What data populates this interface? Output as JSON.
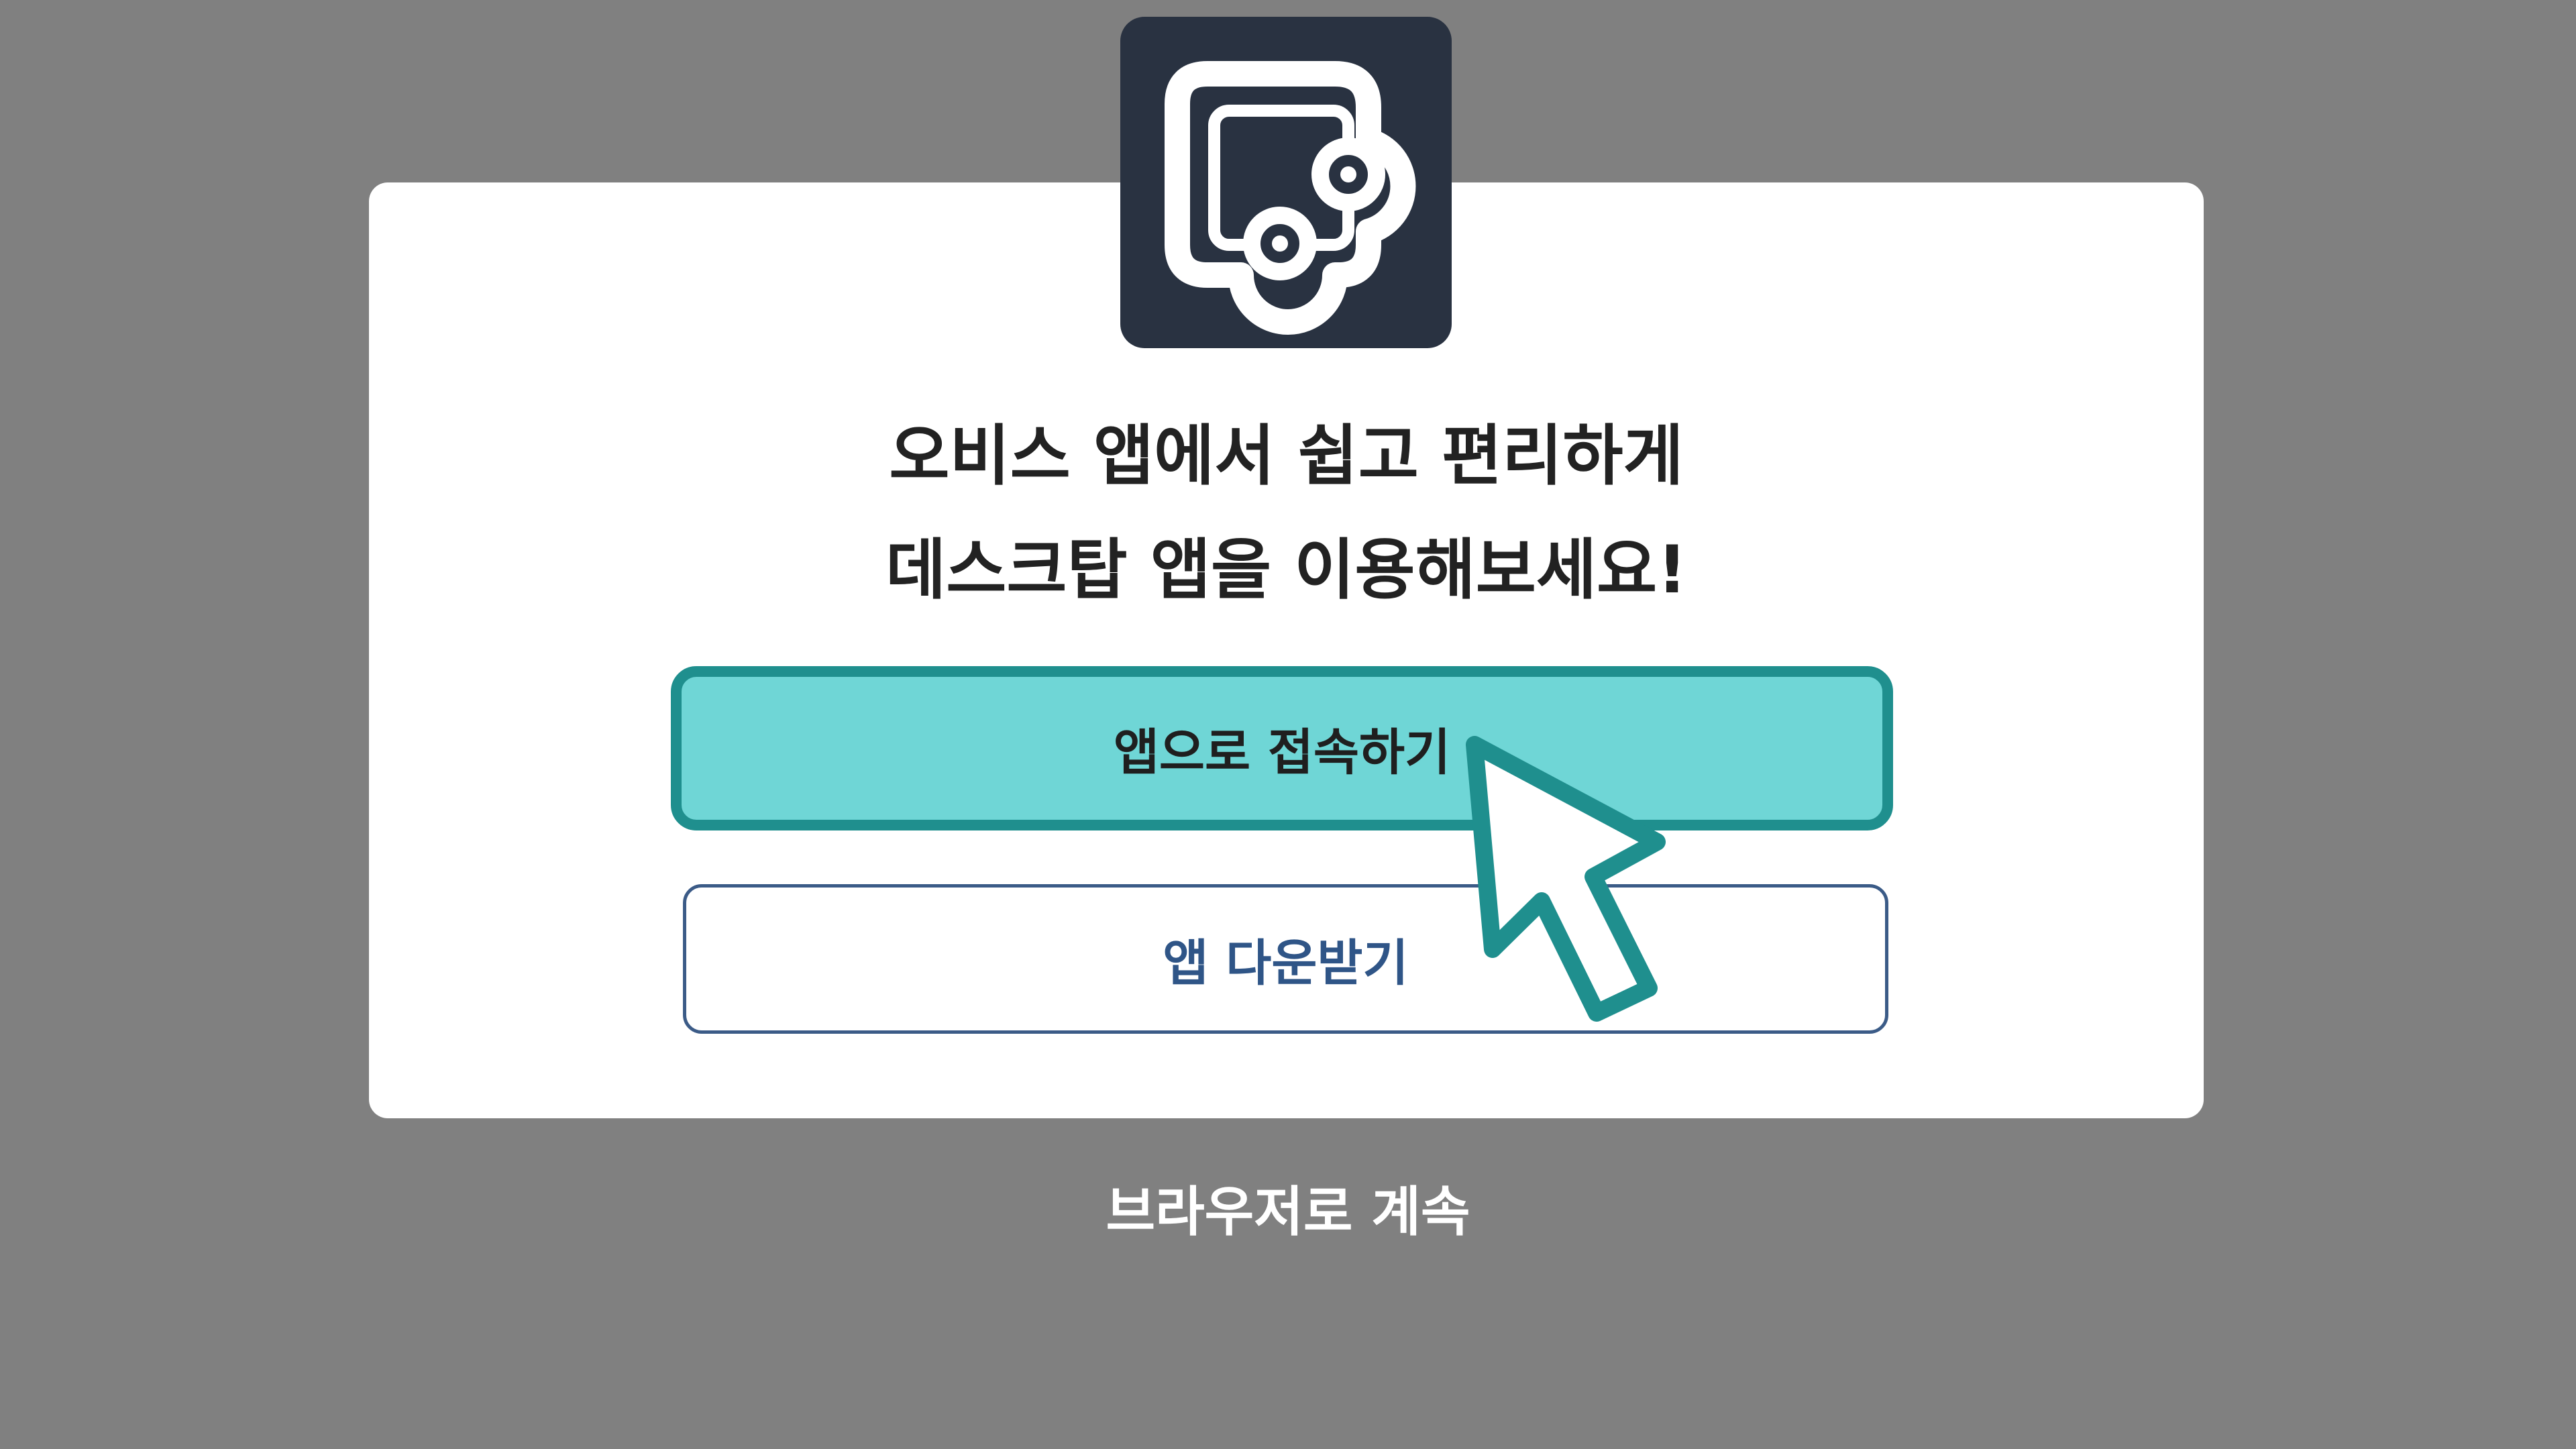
{
  "modal": {
    "headline_line1": "오비스 앱에서 쉽고 편리하게",
    "headline_line2": "데스크탑 앱을 이용해보세요!",
    "primary_button_label": "앱으로 접속하기",
    "secondary_button_label": "앱 다운받기",
    "continue_link_label": "브라우저로 계속"
  },
  "icons": {
    "app_logo": "oVice-app-logo-icon",
    "cursor": "mouse-pointer-icon"
  },
  "colors": {
    "backdrop": "#808080",
    "card": "#ffffff",
    "logo_tile": "#293241",
    "primary_fill": "#6fd6d6",
    "primary_border": "#1f8f8e",
    "secondary_border": "#3b5b87",
    "secondary_text": "#2f5587"
  }
}
